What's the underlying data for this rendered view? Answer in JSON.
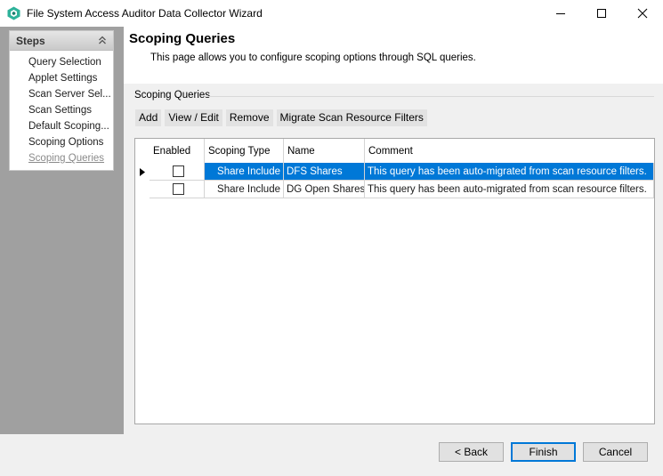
{
  "window": {
    "title": "File System Access Auditor Data Collector Wizard"
  },
  "steps": {
    "title": "Steps",
    "items": [
      {
        "label": "Query Selection"
      },
      {
        "label": "Applet Settings"
      },
      {
        "label": "Scan Server Sel..."
      },
      {
        "label": "Scan Settings"
      },
      {
        "label": "Default Scoping..."
      },
      {
        "label": "Scoping Options"
      },
      {
        "label": "Scoping Queries"
      }
    ],
    "current_index": 6
  },
  "page": {
    "title": "Scoping Queries",
    "description": "This page allows you to configure scoping options through SQL queries."
  },
  "group": {
    "label": "Scoping Queries"
  },
  "toolbar": {
    "add": "Add",
    "view_edit": "View / Edit",
    "remove": "Remove",
    "migrate": "Migrate Scan Resource Filters"
  },
  "grid": {
    "columns": [
      "Enabled",
      "Scoping Type",
      "Name",
      "Comment"
    ],
    "rows": [
      {
        "enabled": false,
        "type": "Share Include",
        "name": "DFS Shares",
        "comment": "This query has been auto-migrated from scan resource filters.",
        "selected": true
      },
      {
        "enabled": false,
        "type": "Share Include",
        "name": "DG Open Shares",
        "comment": "This query has been auto-migrated from scan resource filters.",
        "selected": false
      }
    ]
  },
  "footer": {
    "back": "< Back",
    "finish": "Finish",
    "cancel": "Cancel"
  },
  "colors": {
    "selection": "#0078d7",
    "left_background": "#a0a0a0",
    "content_background": "#f0f0f0"
  },
  "icons": {
    "app": "app-logo-icon",
    "minimize": "minimize-icon",
    "maximize": "maximize-icon",
    "close": "close-icon",
    "collapse": "chevron-double-up-icon",
    "row_indicator": "row-indicator-arrow-icon"
  }
}
